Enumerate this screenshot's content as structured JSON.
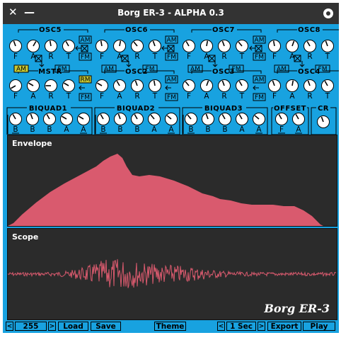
{
  "window": {
    "title": "Borg ER-3 - ALPHA 0.3"
  },
  "titlebar": {
    "close": "✕",
    "minimize": "—"
  },
  "osc_row_top": [
    {
      "name": "OSC5",
      "knobs": [
        "F",
        "A",
        "R",
        "T"
      ]
    },
    {
      "name": "OSC6",
      "knobs": [
        "F",
        "A",
        "R",
        "T"
      ]
    },
    {
      "name": "OSC7",
      "knobs": [
        "F",
        "A",
        "R",
        "T"
      ]
    },
    {
      "name": "OSC8",
      "knobs": [
        "F",
        "A",
        "R",
        "T"
      ]
    }
  ],
  "osc_row_mid": [
    {
      "name": "MSTR",
      "knobs": [
        "F",
        "A",
        "R",
        "T"
      ]
    },
    {
      "name": "OSC2",
      "knobs": [
        "F",
        "A",
        "R",
        "T"
      ]
    },
    {
      "name": "OSC3",
      "knobs": [
        "F",
        "A",
        "R",
        "T"
      ]
    },
    {
      "name": "OSC4",
      "knobs": [
        "F",
        "A",
        "R",
        "T"
      ]
    }
  ],
  "mod_buttons": {
    "am": "AM",
    "fm": "FM",
    "rm": "RM"
  },
  "filters": [
    {
      "name": "BIQUAD1",
      "knobs": [
        "B",
        "B",
        "B",
        "A",
        "A"
      ]
    },
    {
      "name": "BIQUAD2",
      "knobs": [
        "B",
        "B",
        "B",
        "A",
        "A"
      ]
    },
    {
      "name": "BIQUAD3",
      "knobs": [
        "B",
        "B",
        "B",
        "A",
        "A"
      ]
    }
  ],
  "offset": {
    "name": "OFFSET",
    "knobs": [
      "F",
      "A"
    ]
  },
  "cr": {
    "name": "CR"
  },
  "envelope": {
    "label": "Envelope",
    "color": "#d95a6e"
  },
  "scope": {
    "label": "Scope",
    "color": "#d95a6e"
  },
  "brand": "Borg ER-3",
  "bottom": {
    "prev": "<",
    "value": "255",
    "next": ">",
    "load": "Load",
    "save": "Save",
    "theme": "Theme",
    "dur_prev": "<",
    "duration": "1 Sec",
    "dur_next": ">",
    "export": "Export",
    "play": "Play"
  },
  "colors": {
    "bg": "#18a2e0",
    "highlight": "#c8c832",
    "knob": "#ffffff",
    "panel": "#2b2b2b"
  }
}
